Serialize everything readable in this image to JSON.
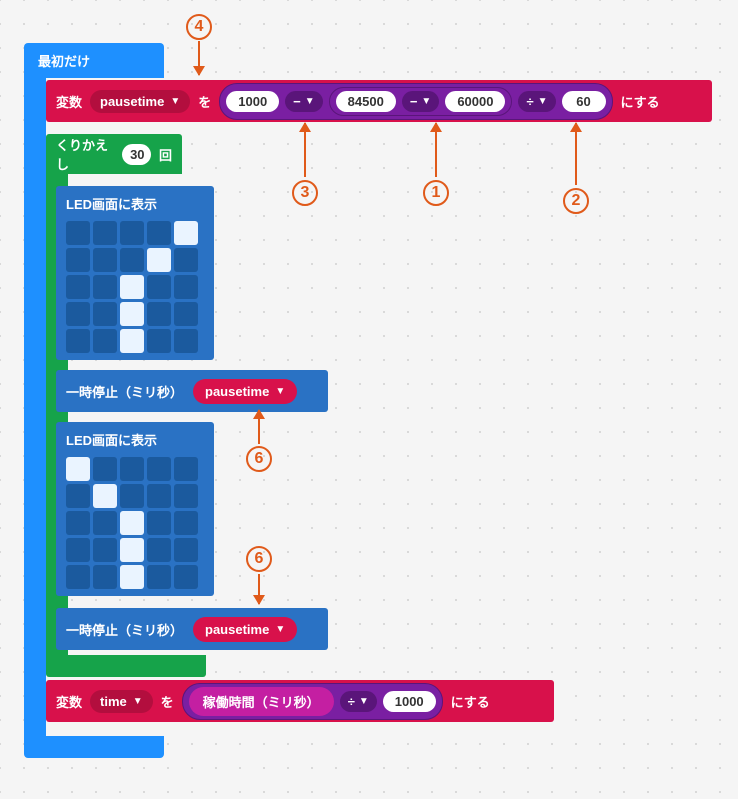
{
  "on_start": {
    "label": "最初だけ"
  },
  "setvar1": {
    "prefix": "変数",
    "var": "pausetime",
    "wo": "を",
    "v1": "1000",
    "op1": "−",
    "v2": "84500",
    "op2": "−",
    "v3": "60000",
    "op3": "÷",
    "v4": "60",
    "suffix": "にする"
  },
  "repeat": {
    "label": "くりかえし",
    "count": "30",
    "times": "回"
  },
  "showleds": {
    "label": "LED画面に表示"
  },
  "led1": [
    [
      0,
      0,
      0,
      0,
      1
    ],
    [
      0,
      0,
      0,
      1,
      0
    ],
    [
      0,
      0,
      1,
      0,
      0
    ],
    [
      0,
      0,
      1,
      0,
      0
    ],
    [
      0,
      0,
      1,
      0,
      0
    ]
  ],
  "led2": [
    [
      1,
      0,
      0,
      0,
      0
    ],
    [
      0,
      1,
      0,
      0,
      0
    ],
    [
      0,
      0,
      1,
      0,
      0
    ],
    [
      0,
      0,
      1,
      0,
      0
    ],
    [
      0,
      0,
      1,
      0,
      0
    ]
  ],
  "pause": {
    "label": "一時停止（ミリ秒）",
    "var": "pausetime"
  },
  "setvar2": {
    "prefix": "変数",
    "var": "time",
    "wo": "を",
    "runtime": "稼働時間（ミリ秒）",
    "op": "÷",
    "val": "1000",
    "suffix": "にする"
  },
  "anno": {
    "n1": "1",
    "n2": "2",
    "n3": "3",
    "n4": "4",
    "n6": "6"
  }
}
